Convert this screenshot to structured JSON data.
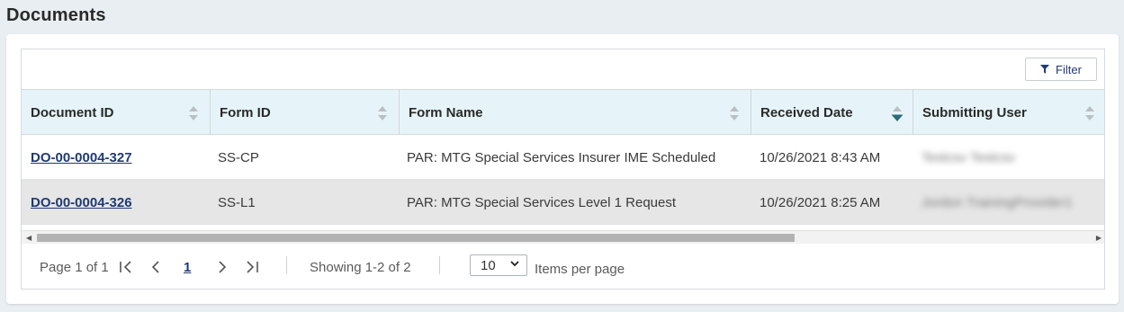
{
  "page": {
    "title": "Documents"
  },
  "toolbar": {
    "filter_label": "Filter"
  },
  "columns": [
    {
      "label": "Document ID",
      "sort": "none"
    },
    {
      "label": "Form ID",
      "sort": "none"
    },
    {
      "label": "Form Name",
      "sort": "none"
    },
    {
      "label": "Received Date",
      "sort": "descending"
    },
    {
      "label": "Submitting User",
      "sort": "none"
    }
  ],
  "rows": [
    {
      "document_id": "DO-00-0004-327",
      "form_id": "SS-CP",
      "form_name": "PAR: MTG Special Services Insurer IME Scheduled",
      "received_date": "10/26/2021 8:43 AM",
      "submitting_user": "Testcsv Testcsv"
    },
    {
      "document_id": "DO-00-0004-326",
      "form_id": "SS-L1",
      "form_name": "PAR: MTG Special Services Level 1 Request",
      "received_date": "10/26/2021 8:25 AM",
      "submitting_user": "Jordon TrainingProvider1"
    }
  ],
  "pager": {
    "page_info": "Page 1 of 1",
    "current_page": "1",
    "showing": "Showing 1-2 of 2",
    "page_size": "10",
    "items_per_page_label": "Items per page"
  },
  "colors": {
    "accent": "#1f3a73",
    "header_bg": "#e6f4f9",
    "alt_row_bg": "#e6e6e6",
    "sort_active": "#2d6b7a"
  }
}
